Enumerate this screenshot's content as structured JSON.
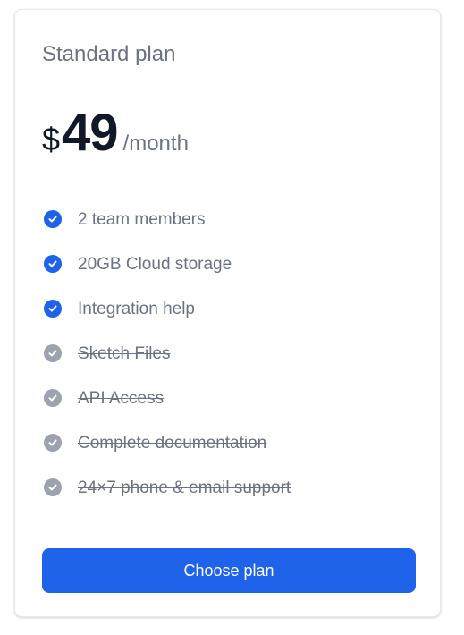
{
  "plan": {
    "name": "Standard plan",
    "currency": "$",
    "amount": "49",
    "period": "/month"
  },
  "features": [
    {
      "label": "2 team members",
      "included": true
    },
    {
      "label": "20GB Cloud storage",
      "included": true
    },
    {
      "label": "Integration help",
      "included": true
    },
    {
      "label": "Sketch Files",
      "included": false
    },
    {
      "label": "API Access",
      "included": false
    },
    {
      "label": "Complete documentation",
      "included": false
    },
    {
      "label": "24×7 phone & email support",
      "included": false
    }
  ],
  "cta": {
    "label": "Choose plan"
  },
  "colors": {
    "accent": "#1e63e9",
    "check_included": "#1e63e9",
    "check_excluded": "#9ca3af",
    "text_muted": "#6b7280",
    "text_dark": "#111827"
  },
  "icons": {
    "included": "check-circle-icon",
    "excluded": "check-circle-icon"
  }
}
